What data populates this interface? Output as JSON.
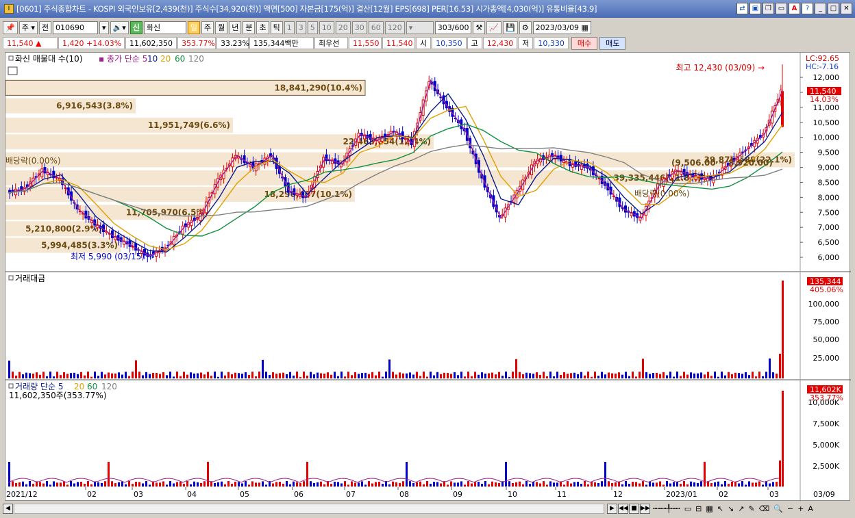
{
  "window": {
    "title": "[0601] 주식종합차트 - KOSPI 외국인보유[2,439(천)] 주식수[34,920(천)] 액면[500] 자본금[175(억)] 결산[12월] EPS[698] PER[16.53] 시가총액[4,030(억)] 유통비율[43.9]",
    "app_icon": "I"
  },
  "toolbar": {
    "market": "주",
    "prev": "전",
    "code": "010690",
    "credit_badge": "신",
    "name": "화신",
    "periods": [
      "일",
      "주",
      "월",
      "년",
      "분",
      "초",
      "틱"
    ],
    "active_period": "일",
    "intervals": [
      "1",
      "3",
      "5",
      "10",
      "20",
      "30",
      "60",
      "120"
    ],
    "count": "303",
    "count_max": "/600",
    "date": "2023/03/09"
  },
  "quote": {
    "price": "11,540 ▲",
    "change": "1,420 +14.03%",
    "volume": "11,602,350",
    "vol_ratio": "353.77%",
    "rate": "33.23%",
    "amount": "135,344백만",
    "priority_label": "최우선",
    "bid1": "11,550",
    "bid2": "11,540",
    "open_label": "시",
    "open": "10,350",
    "high_label": "고",
    "high": "12,430",
    "low_label": "저",
    "low": "10,330",
    "buy": "매수",
    "sell": "매도"
  },
  "main_legend": {
    "title": "화신 매물대 수(10)",
    "ma_label": "종가 단순",
    "ma": [
      "5",
      "10",
      "20",
      "60",
      "120"
    ]
  },
  "colors": {
    "up": "#e50000",
    "down": "#0000cc",
    "ma5": "#a02090",
    "ma10": "#0a1a8a",
    "ma20": "#e0a000",
    "ma60": "#109040",
    "ma120": "#808080",
    "volume_profile": "#f5e6d2"
  },
  "indicator_right": {
    "lc": "LC:92.65",
    "hc": "HC:-7.16"
  },
  "volume_profile": [
    {
      "label": "18,841,290(10.4%)",
      "price": 11650
    },
    {
      "label": "6,916,543(3.8%)",
      "price": 11050
    },
    {
      "label": "11,951,749(6.6%)",
      "price": 10400
    },
    {
      "label": "22,4​63,654(12.4%)",
      "price": 9850
    },
    {
      "label": "39,876,588(22.1%)",
      "price": 9250
    },
    {
      "label": "39,335,446(21.8%)",
      "price": 8650
    },
    {
      "label": "18,296,407(10.1%)",
      "price": 8100
    },
    {
      "label": "11,705,970(6.5%)",
      "price": 7500
    },
    {
      "label": "5,210,800(2.9%)",
      "price": 6950
    },
    {
      "label": "5,994,485(3.3%)",
      "price": 6400
    }
  ],
  "annotations": {
    "high": "최고 12,430 (03/09)",
    "low": "최저 5,990 (03/15)",
    "range": "(9,506.00 ~ 8,920.00)",
    "ex_div1": "배당락(0.00%)",
    "ex_div2": "배당락(0.00%)"
  },
  "price_badge": {
    "price": "11,540",
    "pct": "14.03%"
  },
  "price_axis": [
    "12,000",
    "11,500",
    "11,000",
    "10,500",
    "10,000",
    "9,500",
    "9,000",
    "8,500",
    "8,000",
    "7,500",
    "7,000",
    "6,500",
    "6,000"
  ],
  "amount_panel": {
    "title": "거래대금",
    "badge": "135,344",
    "badge_pct": "405.06%",
    "axis": [
      "100,000",
      "75,000",
      "50,000",
      "25,000"
    ]
  },
  "volume_panel": {
    "title": "거래량",
    "ma_label": "단순",
    "ma": [
      "5",
      "20",
      "60",
      "120"
    ],
    "value": "11,602,350주(353.77%)",
    "badge": "11,602K",
    "badge_pct": "353.77%",
    "axis": [
      "10,000K",
      "7,500K",
      "5,000K",
      "2,500K"
    ]
  },
  "x_axis": [
    "2021/12",
    "02",
    "03",
    "04",
    "05",
    "06",
    "07",
    "08",
    "09",
    "10",
    "11",
    "12",
    "2023/01",
    "02",
    "03"
  ],
  "x_axis_last": "03/09",
  "chart_data": {
    "type": "candlestick",
    "period": "daily",
    "date_range": [
      "2021/12",
      "2023/03/09"
    ],
    "last": {
      "date": "2023/03/09",
      "open": 10350,
      "high": 12430,
      "low": 10330,
      "close": 11540,
      "change": 1420,
      "change_pct": 14.03,
      "volume": 11602350,
      "amount_million": 135344
    },
    "period_high": {
      "value": 12430,
      "date": "03/09"
    },
    "period_low": {
      "value": 5990,
      "date": "03/15"
    },
    "ylim": [
      5800,
      12800
    ],
    "close_path": [
      [
        "2021/12",
        8150
      ],
      [
        "2021/12",
        8300
      ],
      [
        "2022/01",
        8900
      ],
      [
        "2022/01",
        8600
      ],
      [
        "2022/02",
        7600
      ],
      [
        "2022/02",
        7100
      ],
      [
        "2022/02",
        6700
      ],
      [
        "2022/03",
        6400
      ],
      [
        "2022/03",
        6050
      ],
      [
        "2022/03",
        6300
      ],
      [
        "2022/04",
        7000
      ],
      [
        "2022/04",
        7400
      ],
      [
        "2022/05",
        8600
      ],
      [
        "2022/05",
        9400
      ],
      [
        "2022/05",
        9000
      ],
      [
        "2022/06",
        9400
      ],
      [
        "2022/06",
        8200
      ],
      [
        "2022/06",
        8000
      ],
      [
        "2022/07",
        9300
      ],
      [
        "2022/07",
        9100
      ],
      [
        "2022/08",
        10100
      ],
      [
        "2022/08",
        9900
      ],
      [
        "2022/08",
        10200
      ],
      [
        "2022/08",
        9800
      ],
      [
        "2022/09",
        11900
      ],
      [
        "2022/09",
        11000
      ],
      [
        "2022/09",
        10200
      ],
      [
        "2022/10",
        8600
      ],
      [
        "2022/10",
        7300
      ],
      [
        "2022/10",
        8200
      ],
      [
        "2022/11",
        9200
      ],
      [
        "2022/11",
        9400
      ],
      [
        "2022/11",
        9100
      ],
      [
        "2022/12",
        9000
      ],
      [
        "2022/12",
        8400
      ],
      [
        "2022/12",
        7600
      ],
      [
        "2023/01",
        7300
      ],
      [
        "2023/01",
        8400
      ],
      [
        "2023/01",
        8900
      ],
      [
        "2023/02",
        8700
      ],
      [
        "2023/02",
        8600
      ],
      [
        "2023/02",
        9100
      ],
      [
        "2023/03",
        9600
      ],
      [
        "2023/03",
        10120
      ],
      [
        "2023/03/09",
        11540
      ]
    ]
  }
}
